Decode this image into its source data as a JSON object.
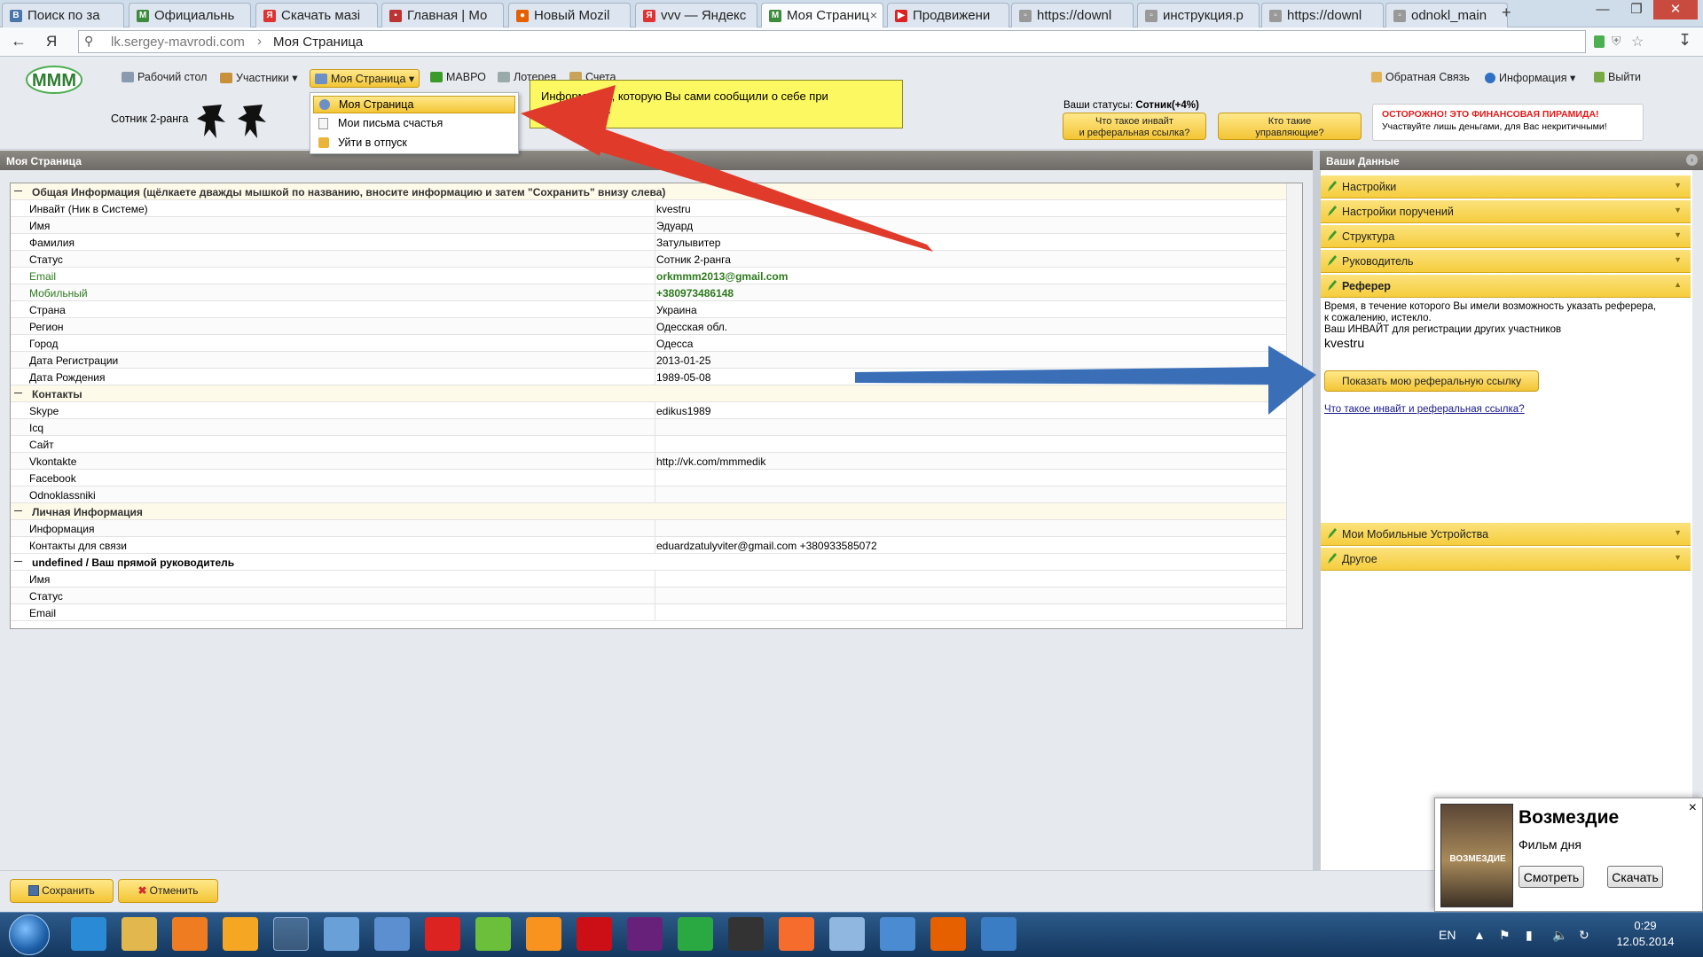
{
  "browser": {
    "tabs": [
      {
        "label": "Поиск по за",
        "icon": "vk-icon",
        "color": "#4a76a8",
        "glyph": "В"
      },
      {
        "label": "Официальнь",
        "icon": "mmm-icon",
        "color": "#3d8b3d",
        "glyph": "M"
      },
      {
        "label": "Скачать мазі",
        "icon": "yandex-icon",
        "color": "#d33",
        "glyph": "Я"
      },
      {
        "label": "Главная | Мо",
        "icon": "folder-icon",
        "color": "#b33",
        "glyph": "▪"
      },
      {
        "label": "Новый Mozil",
        "icon": "firefox-icon",
        "color": "#e66000",
        "glyph": "●"
      },
      {
        "label": "vvv — Яндекс",
        "icon": "yandex-icon",
        "color": "#d33",
        "glyph": "Я"
      },
      {
        "label": "Моя Страниц",
        "icon": "mmm-icon",
        "color": "#3d8b3d",
        "glyph": "M",
        "active": true
      },
      {
        "label": "Продвижени",
        "icon": "youtube-icon",
        "color": "#d22",
        "glyph": "▶"
      },
      {
        "label": "https://downl",
        "icon": "page-icon",
        "color": "#999",
        "glyph": "▫"
      },
      {
        "label": "инструкция.р",
        "icon": "page-icon",
        "color": "#999",
        "glyph": "▫"
      },
      {
        "label": "https://downl",
        "icon": "page-icon",
        "color": "#999",
        "glyph": "▫"
      },
      {
        "label": "odnokl_main",
        "icon": "page-icon",
        "color": "#999",
        "glyph": "▫"
      }
    ],
    "new_tab": "+",
    "url_host": "lk.sergey-mavrodi.com",
    "url_sep": "›",
    "url_title": "Моя Страница",
    "yandex_glyph": "Я"
  },
  "site": {
    "menu": [
      {
        "label": "Рабочий стол",
        "icon": "desktop-icon"
      },
      {
        "label": "Участники ▾",
        "icon": "users-icon"
      },
      {
        "label": "Моя Страница ▾",
        "icon": "user-icon",
        "active": true
      },
      {
        "label": "МАВРО",
        "icon": "butterfly-icon"
      },
      {
        "label": "Лотерея",
        "icon": "lottery-icon"
      },
      {
        "label": "Счета",
        "icon": "accounts-icon"
      }
    ],
    "right_menu": [
      {
        "label": "Обратная Связь",
        "icon": "feedback-icon"
      },
      {
        "label": "Информация ▾",
        "icon": "info-icon"
      },
      {
        "label": "Выйти",
        "icon": "exit-icon"
      }
    ],
    "rank": "Сотник 2-ранга",
    "dropdown": [
      "Моя Страница",
      "Мои письма счастья",
      "Уйти в отпуск"
    ],
    "tooltip": "Информация, которую Вы сами сообщили о себе при регистрации.",
    "status_label": "Ваши статусы:",
    "status_value": "Сотник(+4%)",
    "btn_invite_q": "Что такое инвайт\nи реферальная ссылка?",
    "btn_managers_q": "Кто такие\nуправляющие?",
    "warning_title": "ОСТОРОЖНО! ЭТО ФИНАНСОВАЯ ПИРАМИДА!",
    "warning_text": "Участвуйте лишь деньгами, для Вас некритичными!"
  },
  "left_panel": {
    "title": "Моя Страница",
    "rows": [
      {
        "type": "group",
        "k": "Общая Информация (щёлкаете дважды мышкой по названию, вносите информацию и затем \"Сохранить\" внизу слева)"
      },
      {
        "k": "Инвайт (Ник в Системе)",
        "v": "kvestru"
      },
      {
        "k": "Имя",
        "v": "Эдуард"
      },
      {
        "k": "Фамилия",
        "v": "Затулывитер"
      },
      {
        "k": "Статус",
        "v": "Сотник 2-ранга"
      },
      {
        "k": "Email",
        "v": "orkmmm2013@gmail.com",
        "green": true
      },
      {
        "k": "Мобильный",
        "v": "+380973486148",
        "green": true
      },
      {
        "k": "Страна",
        "v": "Украина"
      },
      {
        "k": "Регион",
        "v": "Одесская обл."
      },
      {
        "k": "Город",
        "v": "Одесса"
      },
      {
        "k": "Дата Регистрации",
        "v": "2013-01-25"
      },
      {
        "k": "Дата Рождения",
        "v": "1989-05-08"
      },
      {
        "type": "group",
        "k": "Контакты"
      },
      {
        "k": "Skype",
        "v": "edikus1989"
      },
      {
        "k": "Icq",
        "v": ""
      },
      {
        "k": "Сайт",
        "v": ""
      },
      {
        "k": "Vkontakte",
        "v": "http://vk.com/mmmedik"
      },
      {
        "k": "Facebook",
        "v": ""
      },
      {
        "k": "Odnoklassniki",
        "v": ""
      },
      {
        "type": "group",
        "k": "Личная Информация"
      },
      {
        "k": "Информация",
        "v": ""
      },
      {
        "k": "Контакты для связи",
        "v": "eduardzatulyviter@gmail.com +380933585072"
      },
      {
        "type": "group2",
        "k": "undefined / Ваш прямой руководитель"
      },
      {
        "k": "Имя",
        "v": ""
      },
      {
        "k": "Статус",
        "v": ""
      },
      {
        "k": "Email",
        "v": ""
      }
    ]
  },
  "right_panel": {
    "title": "Ваши Данные",
    "sections_top": [
      "Настройки",
      "Настройки поручений",
      "Структура",
      "Руководитель"
    ],
    "open_section": "Реферер",
    "referer_text1": "Время, в течение которого Вы имели возможность указать реферера,",
    "referer_text2": "к сожалению, истекло.",
    "invite_caption": "Ваш ИНВАЙТ для регистрации других участников",
    "invite_value": "kvestru",
    "show_link_btn": "Показать мою реферальную ссылку",
    "what_is_link": "Что такое инвайт и реферальная ссылка?",
    "sections_bottom": [
      "Мои Мобильные Устройства",
      "Другое"
    ]
  },
  "bottom": {
    "save": "Сохранить",
    "cancel": "Отменить"
  },
  "popup": {
    "title": "Возмездие",
    "subtitle": "Фильм дня",
    "poster_text": "ВОЗМЕЗДИЕ",
    "watch": "Смотреть",
    "download": "Скачать",
    "close": "×"
  },
  "taskbar": {
    "lang": "EN",
    "time": "0:29",
    "date": "12.05.2014"
  },
  "colors": {
    "accent_yellow": "#f5cd3d",
    "green_text": "#2d7a1d",
    "red_arrow": "#e03a2a",
    "blue_arrow": "#3a6fb8"
  }
}
